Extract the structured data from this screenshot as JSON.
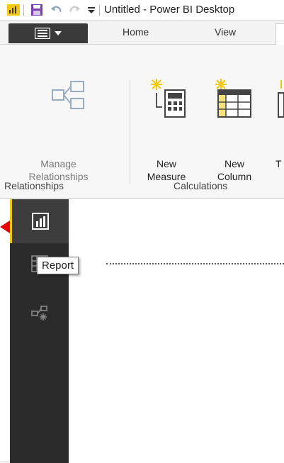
{
  "titlebar": {
    "title": "Untitled - Power BI Desktop",
    "app_icon": "powerbi-app-icon",
    "save_icon": "save-icon",
    "undo_icon": "undo-icon",
    "redo_icon": "redo-icon",
    "qat_icon": "quick-access-dropdown-icon"
  },
  "tabs": {
    "file_icon": "file-menu-icon",
    "home": "Home",
    "view": "View"
  },
  "ribbon": {
    "manage_relationships": {
      "line1": "Manage",
      "line2": "Relationships",
      "enabled": false
    },
    "new_measure": {
      "line1": "New",
      "line2": "Measure"
    },
    "new_column": {
      "line1": "New",
      "line2": "Column"
    },
    "new_table_partial": {
      "line1": "",
      "line2": "T"
    },
    "group_relationships": "Relationships",
    "group_calculations": "Calculations"
  },
  "leftnav": {
    "report_icon": "report-view-icon",
    "data_icon": "data-view-icon",
    "relationships_icon": "relationships-view-icon"
  },
  "tooltip": {
    "text": "Report"
  },
  "colors": {
    "accent_yellow": "#f2c811",
    "nav_background": "#2b2b2b",
    "arrow_red": "#e60000",
    "save_purple": "#7a3fb3"
  }
}
